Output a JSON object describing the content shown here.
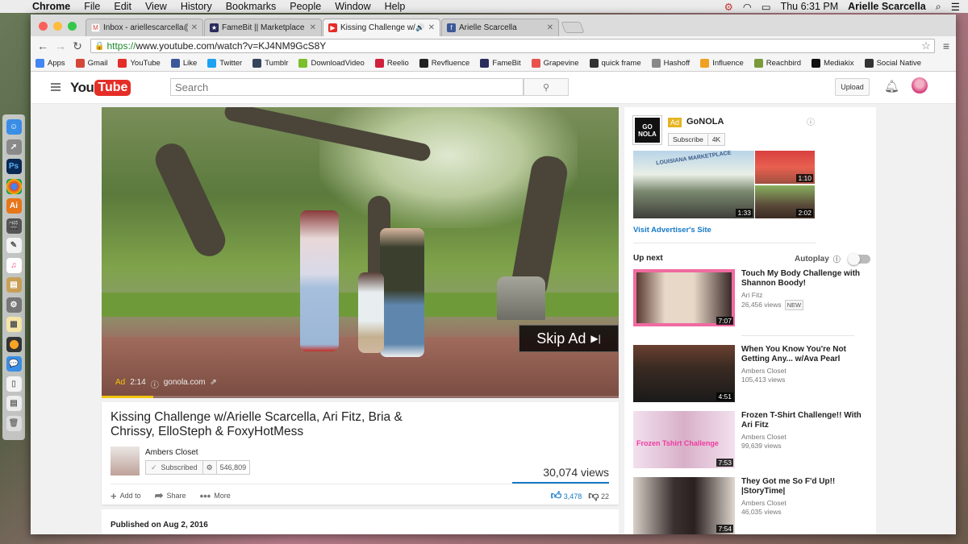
{
  "mac_menubar": {
    "app": "Chrome",
    "menus": [
      "File",
      "Edit",
      "View",
      "History",
      "Bookmarks",
      "People",
      "Window",
      "Help"
    ],
    "clock": "Thu 6:31 PM",
    "user": "Arielle Scarcella"
  },
  "browser": {
    "tabs": [
      {
        "title": "Inbox - ariellescarcella@gm",
        "icon": "gmail-icon"
      },
      {
        "title": "FameBit || Marketplace",
        "icon": "famebit-icon"
      },
      {
        "title": "Kissing Challenge w/Ar",
        "icon": "youtube-icon",
        "active": true
      },
      {
        "title": "Arielle Scarcella",
        "icon": "facebook-icon"
      }
    ],
    "url_scheme": "https://",
    "url_rest": "www.youtube.com/watch?v=KJ4NM9GcS8Y",
    "bookmarks": [
      {
        "label": "Apps",
        "icon": "apps-icon",
        "color": "#4285f4"
      },
      {
        "label": "Gmail",
        "icon": "gmail-icon",
        "color": "#d44638"
      },
      {
        "label": "YouTube",
        "icon": "youtube-icon",
        "color": "#e52d27"
      },
      {
        "label": "Like",
        "icon": "facebook-icon",
        "color": "#3b5998"
      },
      {
        "label": "Twitter",
        "icon": "twitter-icon",
        "color": "#1da1f2"
      },
      {
        "label": "Tumblr",
        "icon": "tumblr-icon",
        "color": "#35465c"
      },
      {
        "label": "DownloadVideo",
        "icon": "download-icon",
        "color": "#7bbf2a"
      },
      {
        "label": "Reelio",
        "icon": "reelio-icon",
        "color": "#d0203b"
      },
      {
        "label": "Revfluence",
        "icon": "revfluence-icon",
        "color": "#222222"
      },
      {
        "label": "FameBit",
        "icon": "famebit-icon",
        "color": "#2b2b5c"
      },
      {
        "label": "Grapevine",
        "icon": "grapevine-icon",
        "color": "#e8544d"
      },
      {
        "label": "quick frame",
        "icon": "quickframe-icon",
        "color": "#333333"
      },
      {
        "label": "Hashoff",
        "icon": "page-icon",
        "color": "#888888"
      },
      {
        "label": "Influence",
        "icon": "influence-icon",
        "color": "#f0a020"
      },
      {
        "label": "Reachbird",
        "icon": "reachbird-icon",
        "color": "#7a9a3a"
      },
      {
        "label": "Mediakix",
        "icon": "mediakix-icon",
        "color": "#111111"
      },
      {
        "label": "Social Native",
        "icon": "socialnative-icon",
        "color": "#333333"
      }
    ]
  },
  "youtube": {
    "logo_you": "You",
    "logo_tube": "Tube",
    "search_placeholder": "Search",
    "upload_label": "Upload",
    "player": {
      "skip_label": "Skip Ad",
      "ad_label": "Ad",
      "ad_time": "2:14",
      "ad_domain": "gonola.com",
      "progress": 0.1
    },
    "video": {
      "title": "Kissing Challenge w/Arielle Scarcella, Ari Fitz, Bria & Chrissy, ElloSteph & FoxyHotMess",
      "channel": "Ambers Closet",
      "subscribed_label": "Subscribed",
      "subscriber_count": "546,809",
      "views": "30,074 views",
      "add_to_label": "Add to",
      "share_label": "Share",
      "more_label": "More",
      "likes": "3,478",
      "dislikes": "22",
      "published": "Published on Aug 2, 2016"
    },
    "ad": {
      "logo_text": "GO NOLA",
      "badge": "Ad",
      "name": "GoNOLA",
      "subscribe_label": "Subscribe",
      "quality": "4K",
      "main_duration": "1:33",
      "thumb1_duration": "1:10",
      "thumb2_duration": "2:02",
      "visit_label": "Visit Advertiser's Site",
      "main_thumb_text": "LOUISIANA MARKETPLACE"
    },
    "upnext": {
      "label": "Up next",
      "autoplay_label": "Autoplay",
      "autoplay_on": false,
      "items": [
        {
          "title": "Touch My Body Challenge with Shannon Boody!",
          "channel": "Ari Fitz",
          "views": "26,456 views",
          "badge": "NEW",
          "duration": "7:07"
        },
        {
          "title": "When You Know You're Not Getting Any... w/Ava Pearl",
          "channel": "Ambers Closet",
          "views": "105,413 views",
          "duration": "4:51"
        },
        {
          "title": "Frozen T-Shirt Challenge!! With Ari Fitz",
          "channel": "Ambers Closet",
          "views": "99,639 views",
          "duration": "7:53",
          "thumb_text": "Frozen Tshirt Challenge"
        },
        {
          "title": "They Got me So F'd Up!! |StoryTime|",
          "channel": "Ambers Closet",
          "views": "46,035 views",
          "duration": "7:54"
        }
      ]
    }
  }
}
